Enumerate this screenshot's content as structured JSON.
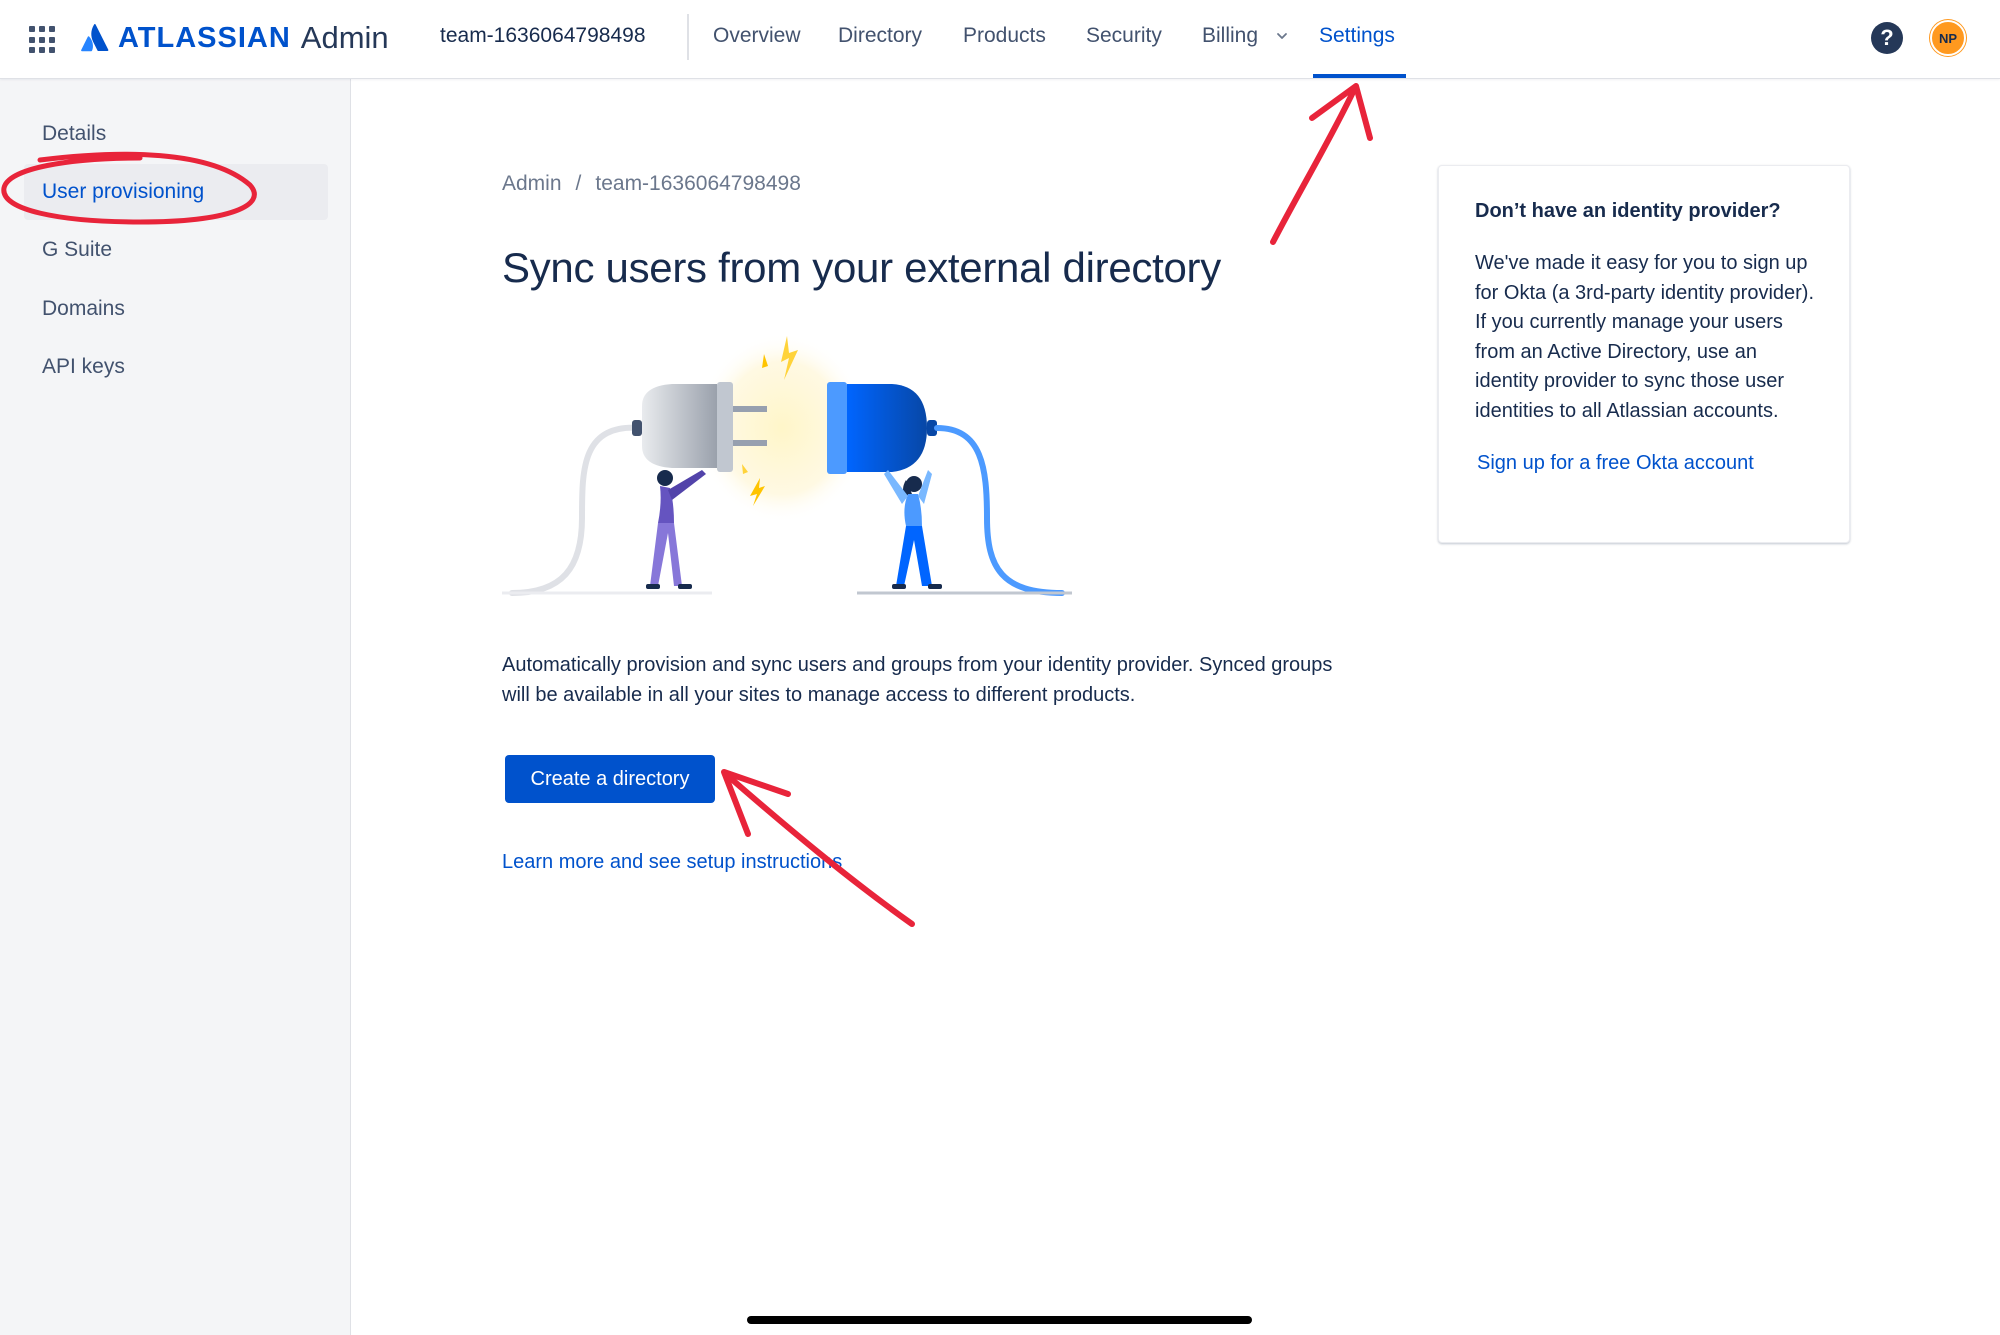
{
  "header": {
    "logo_brand": "ATLASSIAN",
    "logo_product": "Admin",
    "org_name": "team-1636064798498",
    "nav": [
      {
        "label": "Overview"
      },
      {
        "label": "Directory"
      },
      {
        "label": "Products"
      },
      {
        "label": "Security"
      },
      {
        "label": "Billing"
      },
      {
        "label": "Settings",
        "active": true
      }
    ],
    "help_icon": "?",
    "avatar_initials": "NP"
  },
  "sidebar": {
    "items": [
      {
        "label": "Details"
      },
      {
        "label": "User provisioning",
        "active": true
      },
      {
        "label": "G Suite"
      },
      {
        "label": "Domains"
      },
      {
        "label": "API keys"
      }
    ]
  },
  "main": {
    "breadcrumb": [
      "Admin",
      "team-1636064798498"
    ],
    "breadcrumb_sep": "/",
    "title": "Sync users from your external directory",
    "description": "Automatically provision and sync users and groups from your identity provider. Synced groups will be available in all your sites to manage access to different products.",
    "primary_button": "Create a directory",
    "learn_link": "Learn more and see setup instructions"
  },
  "idp_card": {
    "heading": "Don’t have an identity provider?",
    "body": "We've made it easy for you to sign up for Okta (a 3rd-party identity provider). If you currently manage your users from an Active Directory, use an identity provider to sync those user identities to all Atlassian accounts.",
    "link": "Sign up for a free Okta account"
  },
  "colors": {
    "primary": "#0052CC",
    "annotation": "#E8243A",
    "avatar": "#FF991F"
  },
  "icons": [
    "app-switcher-icon",
    "atlassian-logo-icon",
    "chevron-down-icon",
    "help-icon"
  ]
}
